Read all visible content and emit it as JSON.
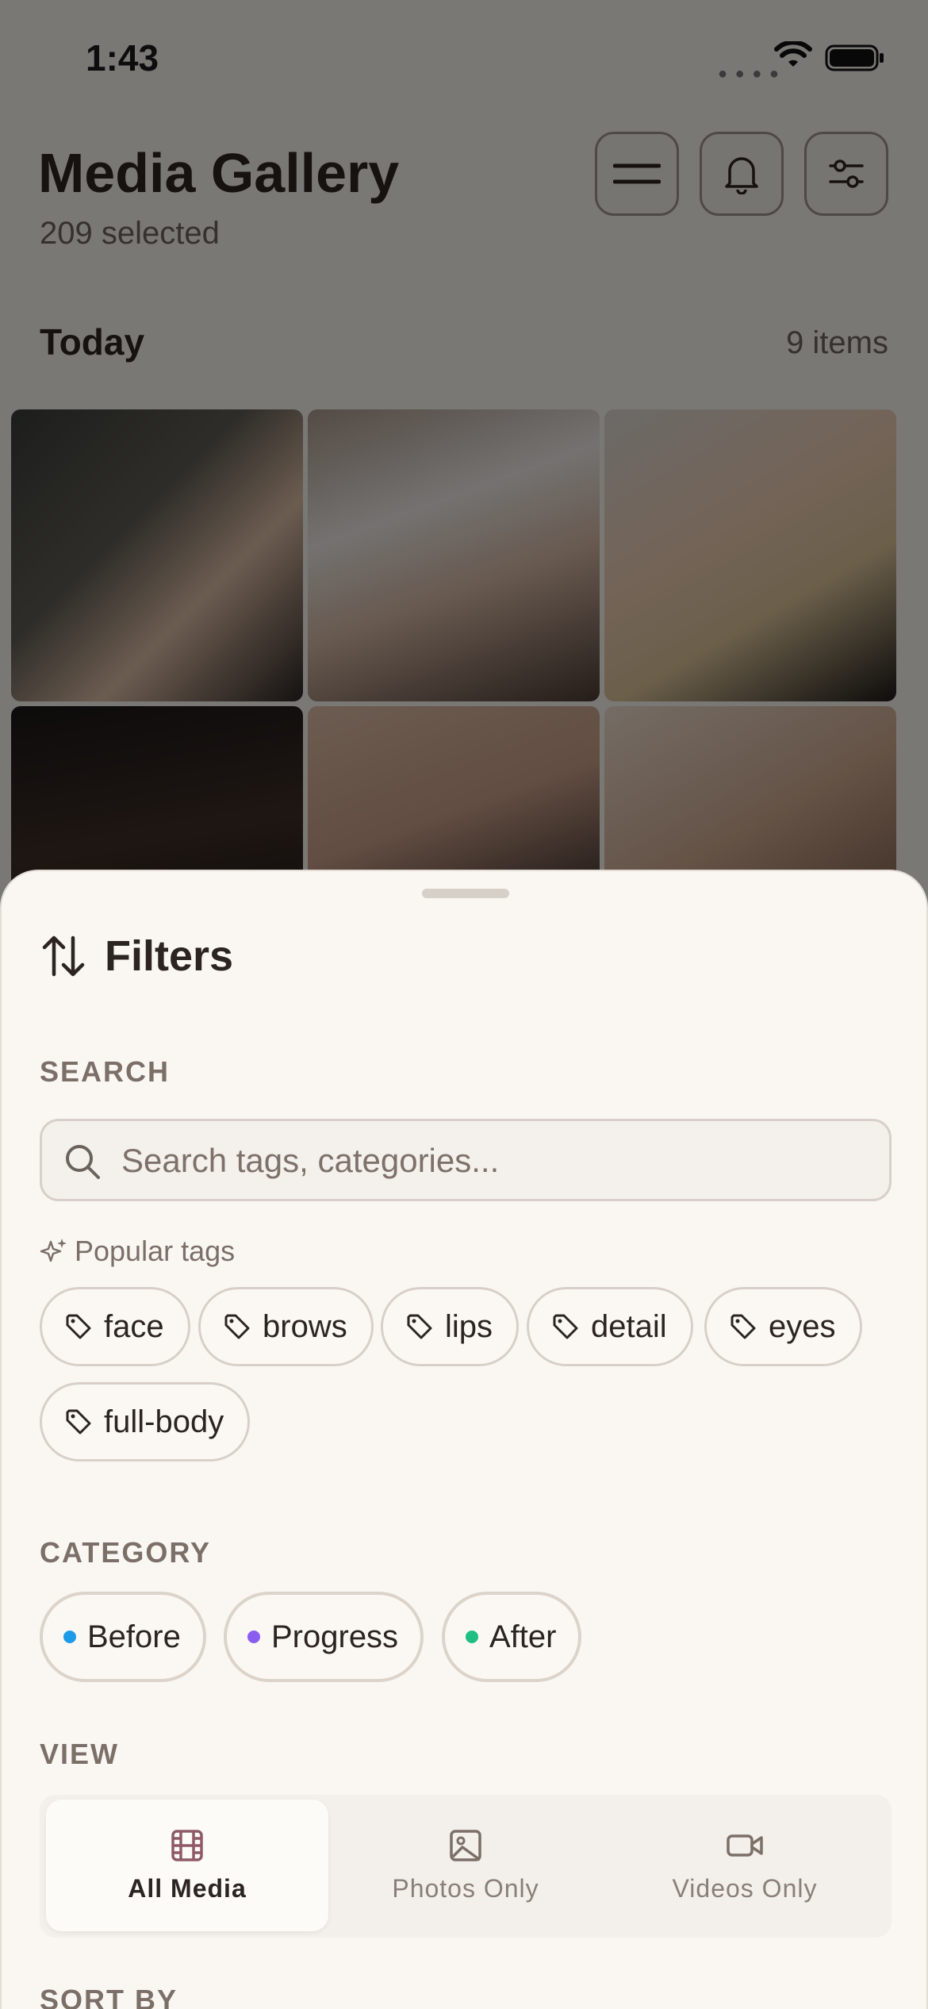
{
  "status_bar": {
    "time": "1:43"
  },
  "header": {
    "title": "Media Gallery",
    "subtitle": "209 selected",
    "buttons": [
      "menu-icon",
      "bell-icon",
      "sliders-icon"
    ]
  },
  "gallery": {
    "section_label": "Today",
    "section_count": "9 items"
  },
  "sheet": {
    "title": "Filters",
    "search_label": "SEARCH",
    "search_placeholder": "Search tags, categories...",
    "search_value": "",
    "popular_label": "Popular tags",
    "tags": [
      "face",
      "brows",
      "lips",
      "detail",
      "eyes",
      "full-body"
    ],
    "category_label": "CATEGORY",
    "categories": [
      {
        "label": "Before",
        "color": "#1e9be8"
      },
      {
        "label": "Progress",
        "color": "#8a5cf0"
      },
      {
        "label": "After",
        "color": "#1fbf84"
      }
    ],
    "view_label": "VIEW",
    "view_options": [
      {
        "label": "All Media",
        "icon": "film-icon",
        "active": true
      },
      {
        "label": "Photos Only",
        "icon": "image-icon",
        "active": false
      },
      {
        "label": "Videos Only",
        "icon": "video-icon",
        "active": false
      }
    ],
    "sort_label": "SORT BY"
  },
  "colors": {
    "background": "#f3f0eb",
    "sheet": "#faf7f3",
    "text": "#2c2420",
    "muted": "#7b6f68"
  }
}
